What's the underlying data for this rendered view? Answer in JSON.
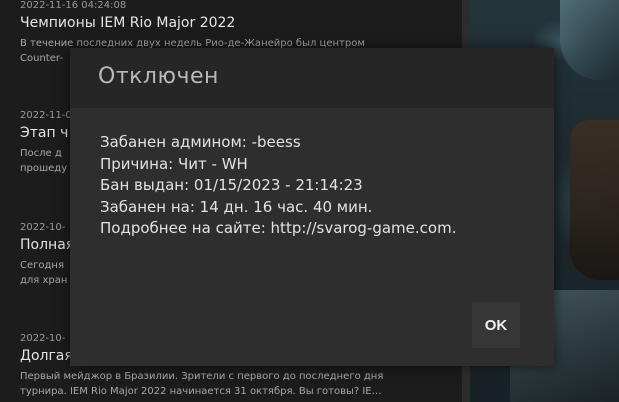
{
  "news": {
    "items": [
      {
        "date": "2022-11-16 04:24:08",
        "title": "Чемпионы IEM Rio Major 2022",
        "desc": [
          "В течение последних двух недель Рио-де-Жанейро был центром",
          "Counter-"
        ]
      },
      {
        "date": "2022-11-0",
        "title": "Этап ч",
        "desc": [
          "После д",
          "прошеду"
        ]
      },
      {
        "date": "2022-10-",
        "title": "Полная",
        "desc": [
          "Сегодня",
          "для хран"
        ]
      },
      {
        "date": "2022-10-",
        "title": "Долгая",
        "desc": [
          "Первый мейджор в Бразилии. Зрители с первого до последнего дня",
          "турнира. IEM Rio Major 2022 начинается 31 октября. Вы готовы? IE…"
        ]
      }
    ]
  },
  "modal": {
    "title": "Отключен",
    "lines": [
      "Забанен админом: -beess",
      "Причина: Чит - WH",
      "Бан выдан: 01/15/2023 - 21:14:23",
      "Забанен на: 14 дн. 16 час. 40 мин.",
      "Подробнее на сайте: http://svarog-game.com."
    ],
    "ok_label": "OK"
  }
}
